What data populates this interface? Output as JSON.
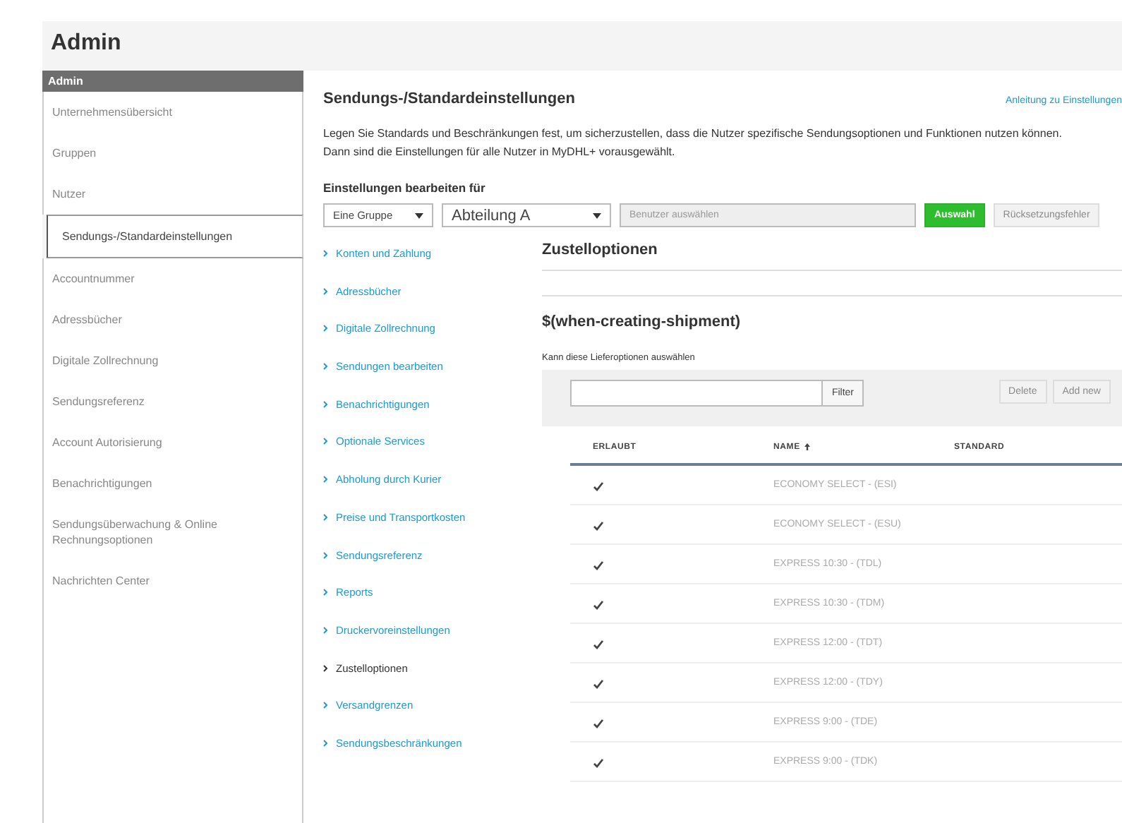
{
  "page_title": "Admin",
  "sidebar": {
    "header": "Admin",
    "items": [
      {
        "label": "Unternehmensübersicht",
        "selected": false
      },
      {
        "label": "Gruppen",
        "selected": false
      },
      {
        "label": "Nutzer",
        "selected": false
      },
      {
        "label": "Sendungs-/Standardeinstellungen",
        "selected": true
      },
      {
        "label": "Accountnummer",
        "selected": false
      },
      {
        "label": "Adressbücher",
        "selected": false
      },
      {
        "label": "Digitale Zollrechnung",
        "selected": false
      },
      {
        "label": "Sendungsreferenz",
        "selected": false
      },
      {
        "label": "Account Autorisierung",
        "selected": false
      },
      {
        "label": "Benachrichtigungen",
        "selected": false
      },
      {
        "label": "Sendungsüberwachung & Online Rechnungsoptionen",
        "selected": false
      },
      {
        "label": "Nachrichten Center",
        "selected": false
      }
    ]
  },
  "main": {
    "title": "Sendungs-/Standardeinstellungen",
    "help_link": "Anleitung zu Einstellungen",
    "description": "Legen Sie Standards und Beschränkungen fest, um sicherzustellen, dass die Nutzer spezifische Sendungsoptionen und Funktionen nutzen können. Dann sind die Einstellungen für alle Nutzer in MyDHL+ vorausgewählt.",
    "edit_for_label": "Einstellungen bearbeiten für",
    "scope_select": {
      "value": "Eine Gruppe"
    },
    "group_select": {
      "value": "Abteilung A"
    },
    "user_field": {
      "placeholder": "Benutzer auswählen"
    },
    "select_button": "Auswahl",
    "reset_button": {
      "label": "Rücksetzungsfehler",
      "disabled": true
    }
  },
  "settings_nav": [
    {
      "label": "Konten und Zahlung",
      "selected": false
    },
    {
      "label": "Adressbücher",
      "selected": false
    },
    {
      "label": "Digitale Zollrechnung",
      "selected": false
    },
    {
      "label": "Sendungen bearbeiten",
      "selected": false
    },
    {
      "label": "Benachrichtigungen",
      "selected": false
    },
    {
      "label": "Optionale Services",
      "selected": false
    },
    {
      "label": "Abholung durch Kurier",
      "selected": false
    },
    {
      "label": "Preise und Transportkosten",
      "selected": false
    },
    {
      "label": "Sendungsreferenz",
      "selected": false
    },
    {
      "label": "Reports",
      "selected": false
    },
    {
      "label": "Druckervoreinstellungen",
      "selected": false
    },
    {
      "label": "Zustelloptionen",
      "selected": true
    },
    {
      "label": "Versandgrenzen",
      "selected": false
    },
    {
      "label": "Sendungsbeschränkungen",
      "selected": false
    }
  ],
  "content": {
    "section_title": "Zustelloptionen",
    "subsection_title": "$(when-creating-shipment)",
    "hint": "Kann diese Lieferoptionen auswählen",
    "filter_button": "Filter",
    "delete_button": {
      "label": "Delete",
      "disabled": true
    },
    "add_button": {
      "label": "Add new",
      "disabled": true
    },
    "table": {
      "columns": [
        {
          "label": "ERLAUBT",
          "sorted": false
        },
        {
          "label": "NAME",
          "sorted": true
        },
        {
          "label": "STANDARD",
          "sorted": false
        }
      ],
      "rows": [
        {
          "allowed": true,
          "name": "ECONOMY SELECT - (ESI)"
        },
        {
          "allowed": true,
          "name": "ECONOMY SELECT - (ESU)"
        },
        {
          "allowed": true,
          "name": "EXPRESS 10:30 - (TDL)"
        },
        {
          "allowed": true,
          "name": "EXPRESS 10:30 - (TDM)"
        },
        {
          "allowed": true,
          "name": "EXPRESS 12:00 - (TDT)"
        },
        {
          "allowed": true,
          "name": "EXPRESS 12:00 - (TDY)"
        },
        {
          "allowed": true,
          "name": "EXPRESS 9:00 - (TDE)"
        },
        {
          "allowed": true,
          "name": "EXPRESS 9:00 - (TDK)"
        }
      ]
    }
  }
}
